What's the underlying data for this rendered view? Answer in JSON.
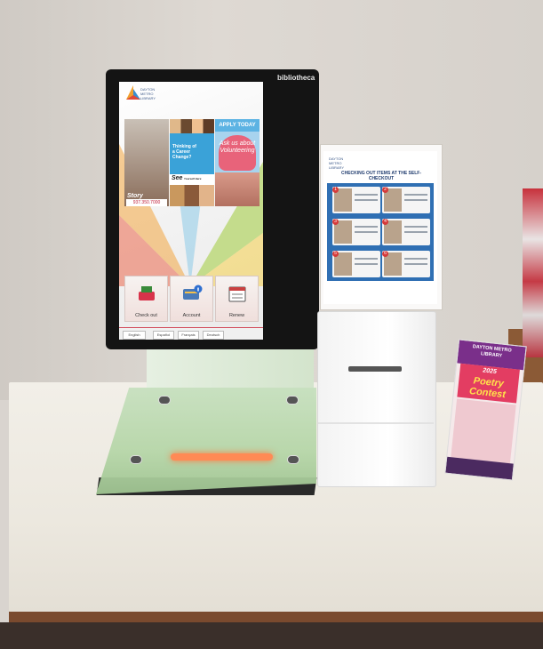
{
  "scene": {
    "kiosk": {
      "brand": "bibliotheca",
      "screen": {
        "library_name": [
          "DAYTON",
          "METRO",
          "LIBRARY"
        ],
        "tiles": {
          "story": {
            "script": "Story",
            "phone": "937.350.7000"
          },
          "career": {
            "text": "Thinking of a Career Change?",
            "see_label": "See",
            "see_sub": "Yourself Here"
          },
          "volunteer": {
            "header": "APPLY TODAY",
            "heart_text": "Ask us about Volunteering"
          }
        },
        "actions": [
          {
            "label": "Check out",
            "icon": "basket-icon"
          },
          {
            "label": "Account",
            "icon": "info-card-icon"
          },
          {
            "label": "Renew",
            "icon": "calendar-icon"
          }
        ],
        "languages": [
          "English",
          "Español",
          "Français",
          "Deutsch"
        ]
      }
    },
    "poster": {
      "logo": [
        "DAYTON",
        "METRO",
        "LIBRARY"
      ],
      "title": "CHECKING OUT ITEMS AT THE SELF-CHECKOUT",
      "steps": [
        "1",
        "2",
        "3",
        "4",
        "5",
        "6"
      ]
    },
    "flyer": {
      "header": [
        "DAYTON METRO",
        "LIBRARY"
      ],
      "year": "2025",
      "title": [
        "Poetry",
        "Contest"
      ]
    },
    "colors": {
      "kiosk_frame": "#141414",
      "poster_panel": "#2f6fb3",
      "pad_light": "#ff8a55",
      "flyer_accent": "#e33d62"
    }
  }
}
